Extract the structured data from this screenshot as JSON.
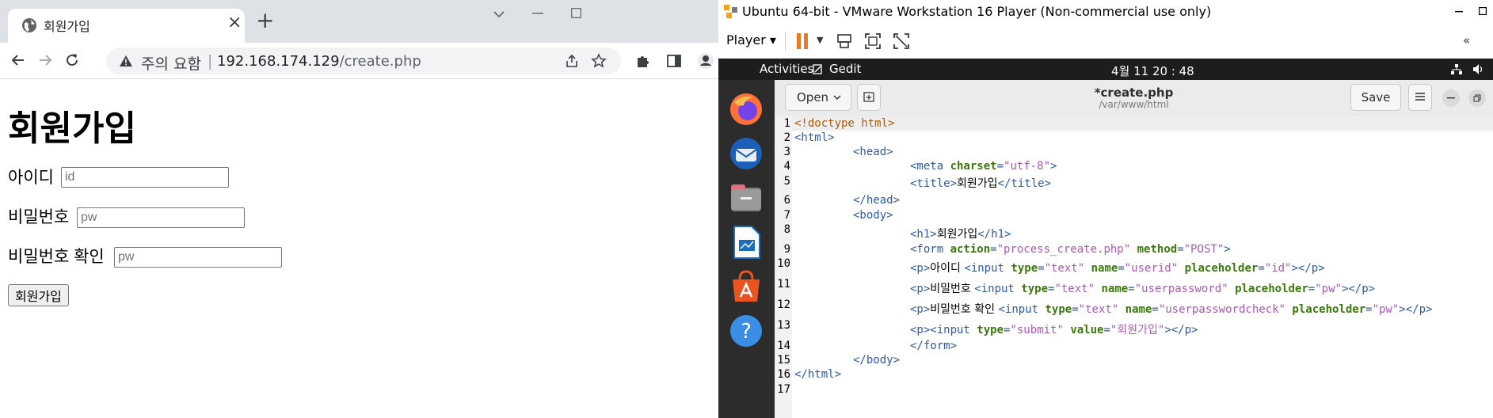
{
  "browser": {
    "tab_title": "회원가입",
    "url_warning": "주의 요함",
    "url_separator": "|",
    "url_host": "192.168.174.129",
    "url_path": "/create.php",
    "page": {
      "heading": "회원가입",
      "fields": [
        {
          "label": "아이디",
          "placeholder": "id"
        },
        {
          "label": "비밀번호",
          "placeholder": "pw"
        },
        {
          "label": "비밀번호 확인",
          "placeholder": "pw"
        }
      ],
      "submit_label": "회원가입"
    }
  },
  "vmware": {
    "window_title": "Ubuntu 64-bit - VMware Workstation 16 Player (Non-commercial use only)",
    "player_menu": "Player",
    "ubuntu": {
      "activities": "Activities",
      "app_name": "Gedit",
      "clock": "4월 11 20 : 48"
    },
    "gedit": {
      "open_label": "Open",
      "file_name": "*create.php",
      "file_path": "/var/www/html",
      "save_label": "Save",
      "line_numbers": [
        "1",
        "2",
        "3",
        "4",
        "5",
        "6",
        "7",
        "8",
        "9",
        "10",
        "11",
        "12",
        "13",
        "14",
        "15",
        "16",
        "17"
      ]
    }
  }
}
